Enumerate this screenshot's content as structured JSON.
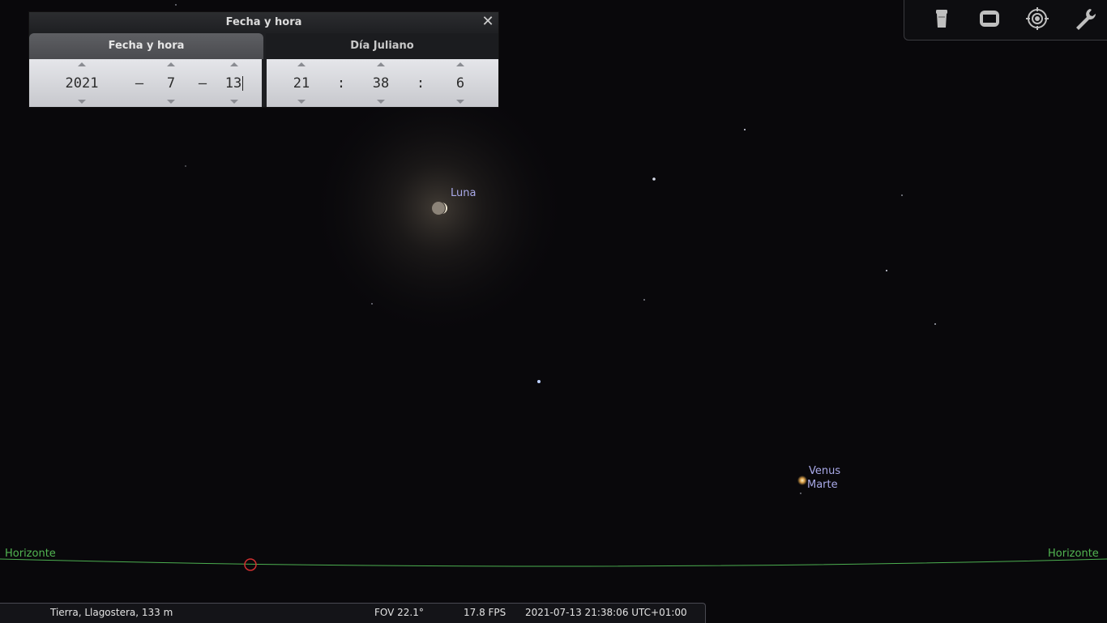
{
  "dialog": {
    "title": "Fecha y hora",
    "tabs": [
      {
        "label": "Fecha y hora",
        "active": true
      },
      {
        "label": "Día Juliano",
        "active": false
      }
    ],
    "date": {
      "year": "2021",
      "month": "7",
      "day": "13",
      "separator": "–"
    },
    "time": {
      "hour": "21",
      "minute": "38",
      "second": "6",
      "separator": ":"
    },
    "close_icon": "close-icon"
  },
  "toolbar": {
    "buttons": [
      {
        "name": "telescope-button",
        "icon": "ocular-icon"
      },
      {
        "name": "screen-button",
        "icon": "screen-icon"
      },
      {
        "name": "target-button",
        "icon": "target-icon"
      },
      {
        "name": "settings-button",
        "icon": "wrench-icon"
      }
    ]
  },
  "sky": {
    "objects": {
      "moon": "Luna",
      "venus": "Venus",
      "mars": "Marte"
    },
    "horizon_left": "Horizonte",
    "horizon_right": "Horizonte",
    "colors": {
      "horizon": "#4caf50",
      "label": "#a9a9e8",
      "cardinal": "#d03030"
    }
  },
  "statusbar": {
    "location": "Tierra, Llagostera, 133 m",
    "fov": "FOV 22.1°",
    "fps": "17.8 FPS",
    "datetime": "2021-07-13 21:38:06 UTC+01:00"
  }
}
